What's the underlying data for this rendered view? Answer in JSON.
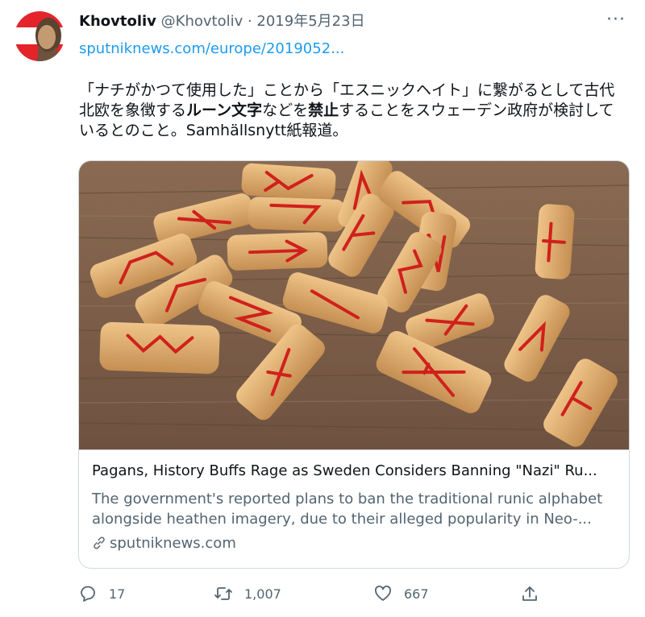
{
  "tweet": {
    "display_name": "Khovtoliv",
    "handle_date": "@Khovtoliv · 2019年5月23日",
    "more_label": "···",
    "link": "sputniknews.com/europe/2019052...",
    "text_1": "「ナチがかつて使用した」ことから「エスニックヘイト」に繋がるとして古代北欧を象徴する",
    "text_bold_1": "ルーン文字",
    "text_2": "などを",
    "text_bold_2": "禁止",
    "text_3": "することをスウェーデン政府が検討しているとのこと。Samhällsnytt紙報道。"
  },
  "card": {
    "image_alt": "Wooden rune tiles with red carved runes",
    "title": "Pagans, History Buffs Rage as Sweden Considers Banning \"Nazi\" Ru...",
    "description": "The government's reported plans to ban the traditional runic alphabet alongside heathen imagery, due to their alleged popularity in Neo-...",
    "domain": "sputniknews.com"
  },
  "actions": {
    "reply_count": "17",
    "retweet_count": "1,007",
    "like_count": "667"
  },
  "icons": {
    "reply": "speech-bubble-icon",
    "retweet": "retweet-arrows-icon",
    "like": "heart-icon",
    "share": "share-upload-icon",
    "link": "chain-link-icon"
  },
  "colors": {
    "link": "#1d9bf0",
    "secondary": "#536471",
    "rune": "#d0201c"
  }
}
